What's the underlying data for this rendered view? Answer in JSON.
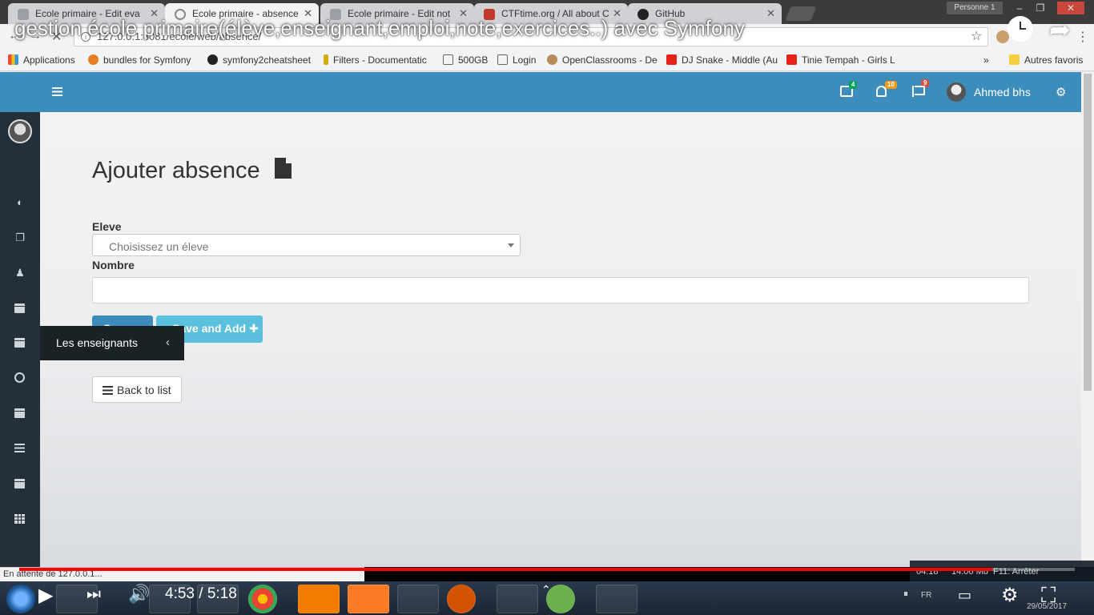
{
  "browser": {
    "tabs": [
      {
        "label": "Ecole primaire - Edit eva"
      },
      {
        "label": "Ecole primaire - absence"
      },
      {
        "label": "Ecole primaire - Edit not"
      },
      {
        "label": "CTFtime.org / All about C"
      },
      {
        "label": "GitHub"
      }
    ],
    "person_label": "Personne 1",
    "url": "127.0.0.1:8081/ecole/web/absence/",
    "bookmarks": [
      {
        "label": "Applications"
      },
      {
        "label": "bundles for Symfony"
      },
      {
        "label": "symfony2cheatsheet"
      },
      {
        "label": "Filters - Documentatic"
      },
      {
        "label": "500GB"
      },
      {
        "label": "Login"
      },
      {
        "label": "OpenClassrooms - De"
      },
      {
        "label": "DJ Snake - Middle (Au"
      },
      {
        "label": "Tinie Tempah - Girls L"
      }
    ],
    "bookmarks_more": "»",
    "other_bookmarks": "Autres favoris",
    "status_text": "En attente de 127.0.0.1..."
  },
  "video": {
    "title": "gestion école primaire(élève,enseignant,emploi,note,exercices..) avec Symfony",
    "time": "4:53 / 5:18",
    "progress": 0.922,
    "colors": {
      "progress": "#ff0000"
    }
  },
  "header": {
    "mail_count": "4",
    "notif_count": "10",
    "flag_count": "9",
    "user_name": "Ahmed bhs",
    "colors": {
      "bar": "#3c8dbc",
      "mail_badge": "#00a65a",
      "notif_badge": "#f39c12",
      "flag_badge": "#dd4b39"
    }
  },
  "sidebar": {
    "flyout_label": "Les enseignants",
    "icons": [
      "dashboard-icon",
      "clone-icon",
      "child-icon",
      "calendar-icon",
      "calendar-icon",
      "clock-icon",
      "calendar-icon",
      "list-icon",
      "calendar-alt-icon",
      "grid-icon"
    ]
  },
  "form": {
    "title": "Ajouter absence",
    "eleve_label": "Eleve",
    "eleve_placeholder": "Choisissez un éleve",
    "nombre_label": "Nombre",
    "save_label": "Save",
    "save_add_label": "Save and Add",
    "back_label": "Back to list"
  },
  "taskbar": {
    "tray_left": "04:18",
    "tray_mid": "14.06 Mb",
    "tray_right": "F11: Arrêter",
    "lang": "FR",
    "date": "29/05/2017"
  }
}
